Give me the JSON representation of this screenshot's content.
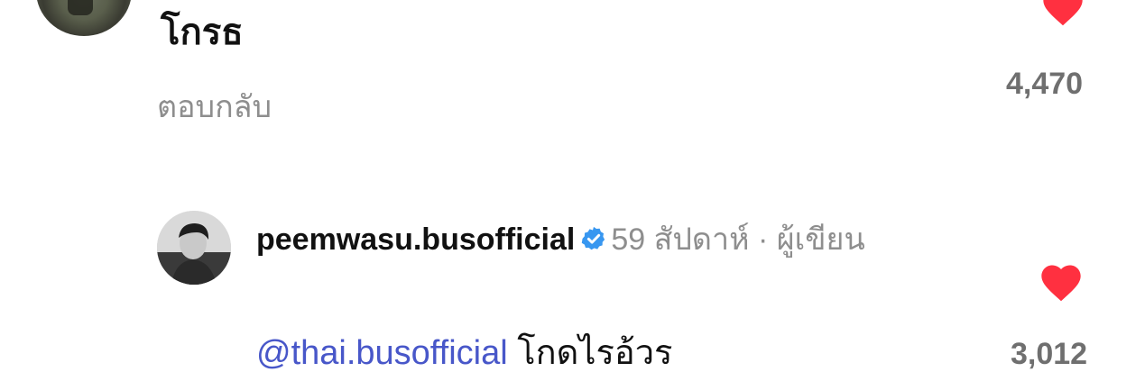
{
  "comment_top": {
    "text": "โกรธ",
    "reply_label": "ตอบกลับ",
    "like_count": "4,470",
    "liked": true
  },
  "comment_bottom": {
    "username": "peemwasu.busofficial",
    "verified": true,
    "time": "59 สัปดาห์",
    "separator": "·",
    "author_label": "ผู้เขียน",
    "mention": "@thai.busofficial",
    "text": "โกดไรอ้วร",
    "like_count": "3,012",
    "liked": true
  },
  "colors": {
    "heart": "#ff3040",
    "mention": "#4857c9",
    "verified": "#3897f0",
    "muted_text": "#8e8e8e",
    "like_count": "#6f6f6f"
  },
  "icons": {
    "like": "heart-filled-icon",
    "verified": "verified-badge-icon"
  }
}
